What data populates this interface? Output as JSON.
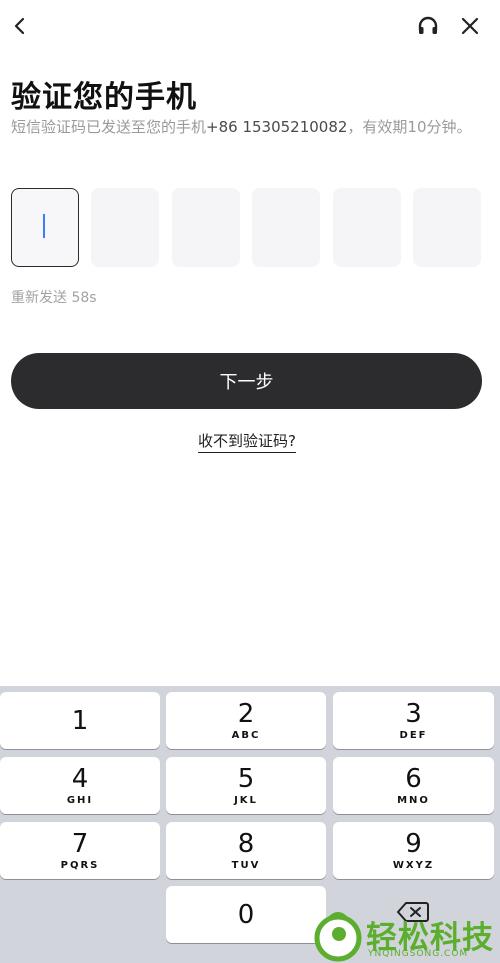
{
  "header": {
    "title": "验证您的手机",
    "subtitle_prefix": "短信验证码已发送至您的手机",
    "phone": "+86 15305210082",
    "subtitle_suffix": "，有效期10分钟。"
  },
  "code_boxes": [
    "",
    "",
    "",
    "",
    "",
    ""
  ],
  "resend": {
    "label": "重新发送 58s"
  },
  "next_button": {
    "label": "下一步"
  },
  "no_code_link": {
    "label": "收不到验证码?"
  },
  "keyboard": {
    "keys": [
      {
        "num": "1",
        "letters": ""
      },
      {
        "num": "2",
        "letters": "ABC"
      },
      {
        "num": "3",
        "letters": "DEF"
      },
      {
        "num": "4",
        "letters": "GHI"
      },
      {
        "num": "5",
        "letters": "JKL"
      },
      {
        "num": "6",
        "letters": "MNO"
      },
      {
        "num": "7",
        "letters": "PQRS"
      },
      {
        "num": "8",
        "letters": "TUV"
      },
      {
        "num": "9",
        "letters": "WXYZ"
      },
      {
        "num": "0",
        "letters": ""
      }
    ]
  },
  "icons": {
    "back": "chevron-left-icon",
    "headset": "headset-icon",
    "close": "close-icon",
    "backspace": "backspace-icon"
  },
  "watermark": {
    "text": "轻松科技",
    "sub": "YNQINGSONG.COM"
  },
  "colors": {
    "accent": "#2c2c2e",
    "caret": "#3d7cf5",
    "muted": "#9a9a9a",
    "watermark": "#5cae2e"
  }
}
